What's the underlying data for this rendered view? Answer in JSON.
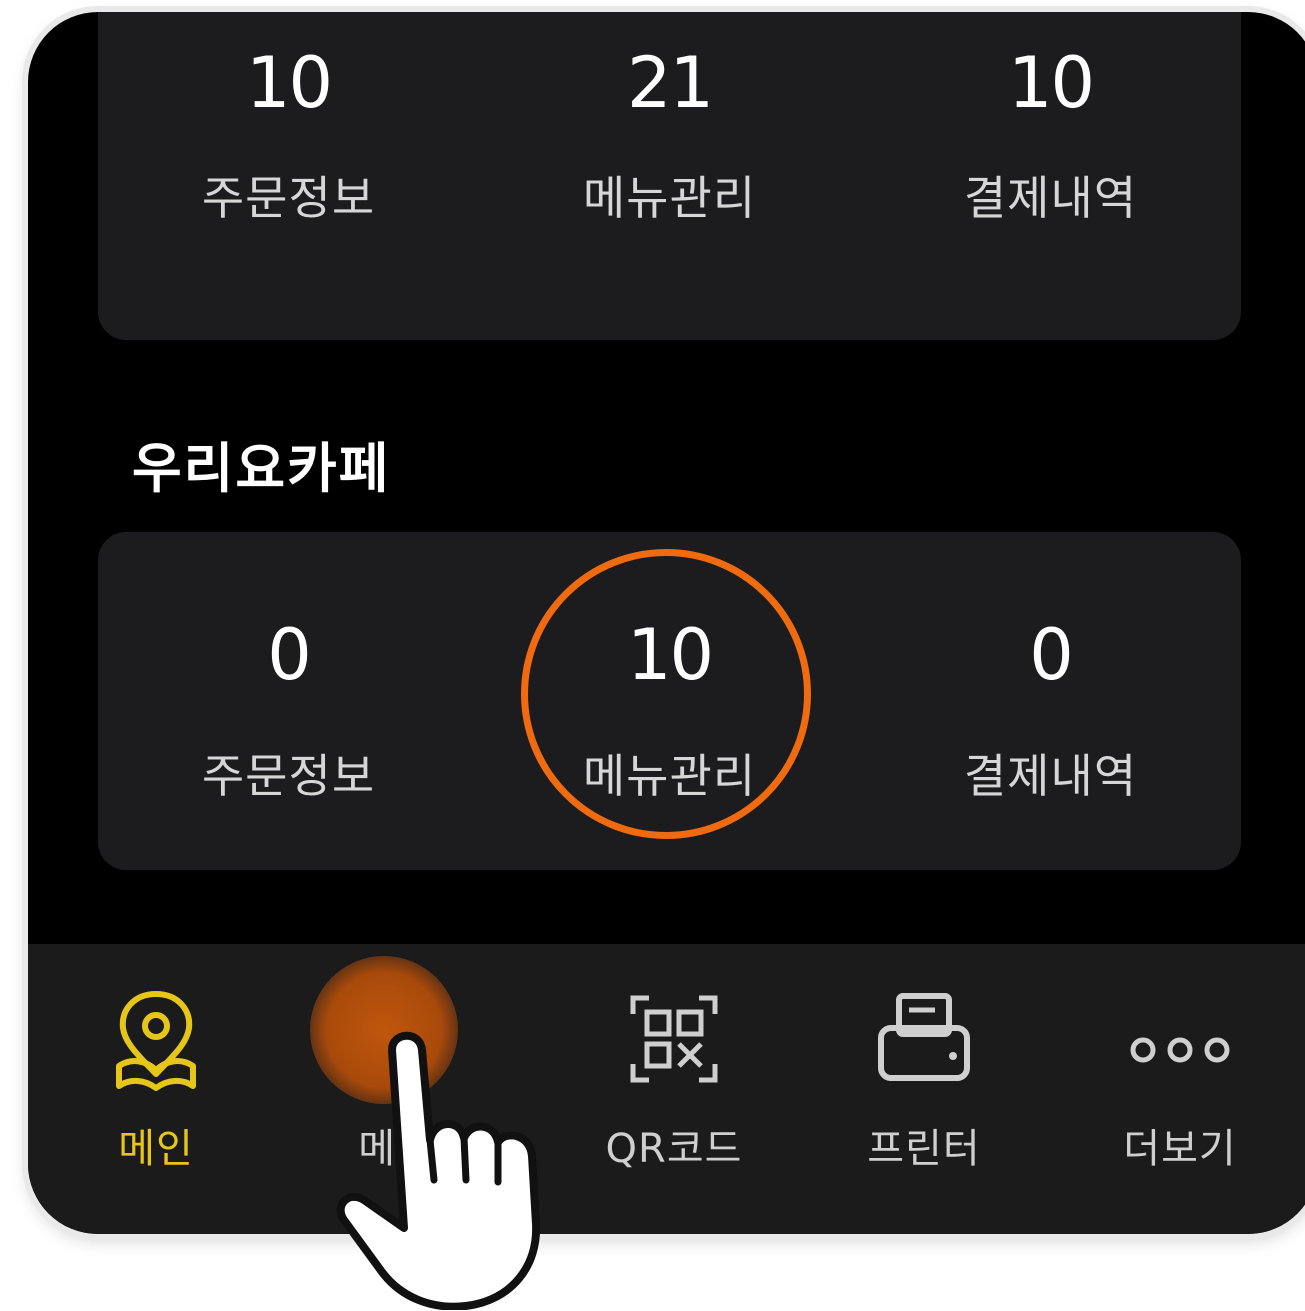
{
  "stores": [
    {
      "name": "",
      "stats": [
        {
          "value": "10",
          "label": "주문정보"
        },
        {
          "value": "21",
          "label": "메뉴관리"
        },
        {
          "value": "10",
          "label": "결제내역"
        }
      ]
    },
    {
      "name": "우리요카페",
      "stats": [
        {
          "value": "0",
          "label": "주문정보"
        },
        {
          "value": "10",
          "label": "메뉴관리"
        },
        {
          "value": "0",
          "label": "결제내역"
        }
      ]
    }
  ],
  "tabbar": {
    "items": [
      {
        "label": "메인",
        "icon": "map-pin-book-icon",
        "active": true
      },
      {
        "label": "메뉴",
        "icon": "menu-add-icon",
        "active": false
      },
      {
        "label": "QR코드",
        "icon": "qr-code-icon",
        "active": false
      },
      {
        "label": "프린터",
        "icon": "printer-icon",
        "active": false
      },
      {
        "label": "더보기",
        "icon": "more-dots-icon",
        "active": false
      }
    ]
  },
  "colors": {
    "background": "#000000",
    "card": "#1c1c1e",
    "tabbar": "#1b1b1b",
    "active_tab": "#e6c619",
    "highlight": "#f06a10"
  }
}
